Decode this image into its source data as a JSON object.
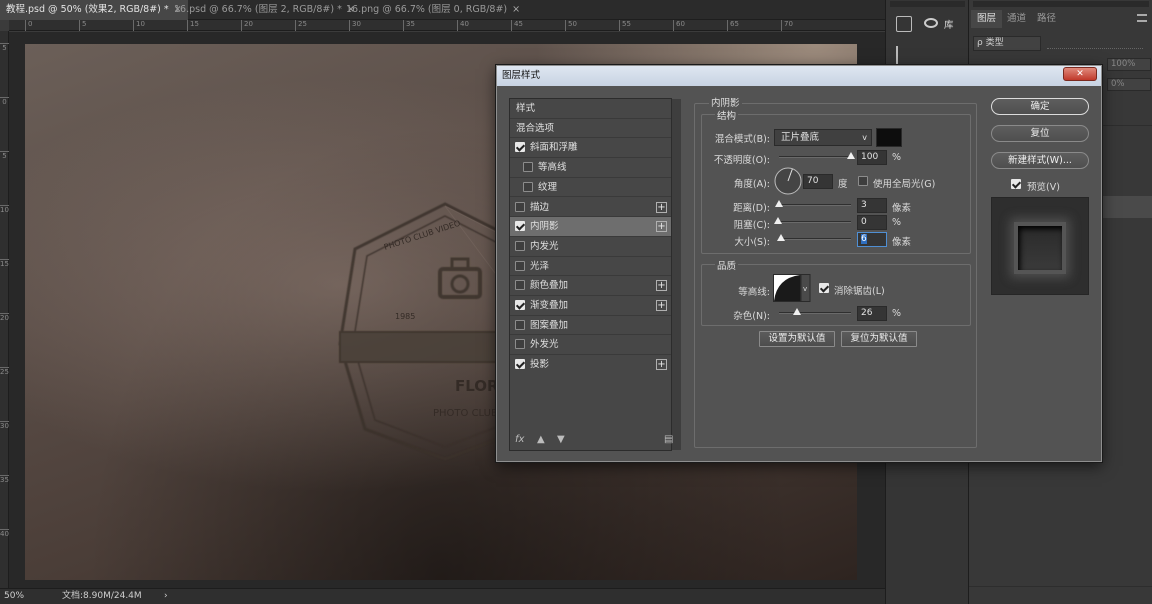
{
  "tabs": [
    {
      "label": "教程.psd @ 50% (效果2, RGB/8#) *",
      "active": true
    },
    {
      "label": "16.psd @ 66.7% (图层 2, RGB/8#) *",
      "active": false
    },
    {
      "label": "16.png @ 66.7% (图层 0, RGB/8#)",
      "active": false
    }
  ],
  "tab_close": "×",
  "ruler_h": [
    "0",
    "5",
    "10",
    "15",
    "20",
    "25",
    "30",
    "35",
    "40",
    "45",
    "50",
    "55",
    "60",
    "65",
    "70"
  ],
  "ruler_v": [
    "5",
    "0",
    "5",
    "1\n0",
    "1\n5",
    "2\n0",
    "2\n5",
    "3\n0",
    "3\n5",
    "4\n0"
  ],
  "status": {
    "zoom": "50%",
    "doc": "文档:8.90M/24.4M",
    "arrow": "›"
  },
  "midstrip": {
    "library": "库"
  },
  "panel_tabs": [
    "图层",
    "通道",
    "路径"
  ],
  "layers": {
    "filter_kind": "ρ 类型",
    "opacity_label": "100%",
    "fill_label": "0%"
  },
  "dialog": {
    "title": "图层样式",
    "close": "✕",
    "styles": [
      {
        "label": "样式",
        "check": null,
        "plus": false,
        "indent": 0
      },
      {
        "label": "混合选项",
        "check": null,
        "plus": false,
        "indent": 0
      },
      {
        "label": "斜面和浮雕",
        "check": true,
        "plus": false,
        "indent": 0
      },
      {
        "label": "等高线",
        "check": false,
        "plus": false,
        "indent": 1
      },
      {
        "label": "纹理",
        "check": false,
        "plus": false,
        "indent": 1
      },
      {
        "label": "描边",
        "check": false,
        "plus": true,
        "indent": 0
      },
      {
        "label": "内阴影",
        "check": true,
        "plus": true,
        "indent": 0,
        "selected": true
      },
      {
        "label": "内发光",
        "check": false,
        "plus": false,
        "indent": 0
      },
      {
        "label": "光泽",
        "check": false,
        "plus": false,
        "indent": 0
      },
      {
        "label": "颜色叠加",
        "check": false,
        "plus": true,
        "indent": 0
      },
      {
        "label": "渐变叠加",
        "check": true,
        "plus": true,
        "indent": 0
      },
      {
        "label": "图案叠加",
        "check": false,
        "plus": false,
        "indent": 0
      },
      {
        "label": "外发光",
        "check": false,
        "plus": false,
        "indent": 0
      },
      {
        "label": "投影",
        "check": true,
        "plus": true,
        "indent": 0
      }
    ],
    "fx": "fx",
    "section": "内阴影",
    "structure": {
      "title": "结构",
      "blend_label": "混合模式(B):",
      "blend_value": "正片叠底",
      "blend_color": "#0d0d0d",
      "opacity_label": "不透明度(O):",
      "opacity_value": "100",
      "opacity_unit": "%",
      "opacity_level": 1.0,
      "angle_label": "角度(A):",
      "angle_value": "70",
      "angle_unit": "度",
      "global_light": "使用全局光(G)",
      "distance_label": "距离(D):",
      "distance_value": "3",
      "distance_unit": "像素",
      "distance_level": 0.02,
      "choke_label": "阻塞(C):",
      "choke_value": "0",
      "choke_unit": "%",
      "choke_level": 0.0,
      "size_label": "大小(S):",
      "size_value": "6",
      "size_unit": "像素",
      "size_level": 0.03
    },
    "quality": {
      "title": "品质",
      "contour_label": "等高线:",
      "antialias": "消除锯齿(L)",
      "noise_label": "杂色(N):",
      "noise_value": "26",
      "noise_unit": "%",
      "noise_level": 0.26
    },
    "set_default": "设置为默认值",
    "reset_default": "复位为默认值",
    "ok": "确定",
    "reset": "复位",
    "new_style": "新建样式(W)...",
    "preview": "预览(V)"
  },
  "logo": {
    "line1": "PHOTO CLUB VIDEO",
    "line2": "FLORI",
    "line3": "PHOTO CLUB",
    "tag": "1985"
  }
}
